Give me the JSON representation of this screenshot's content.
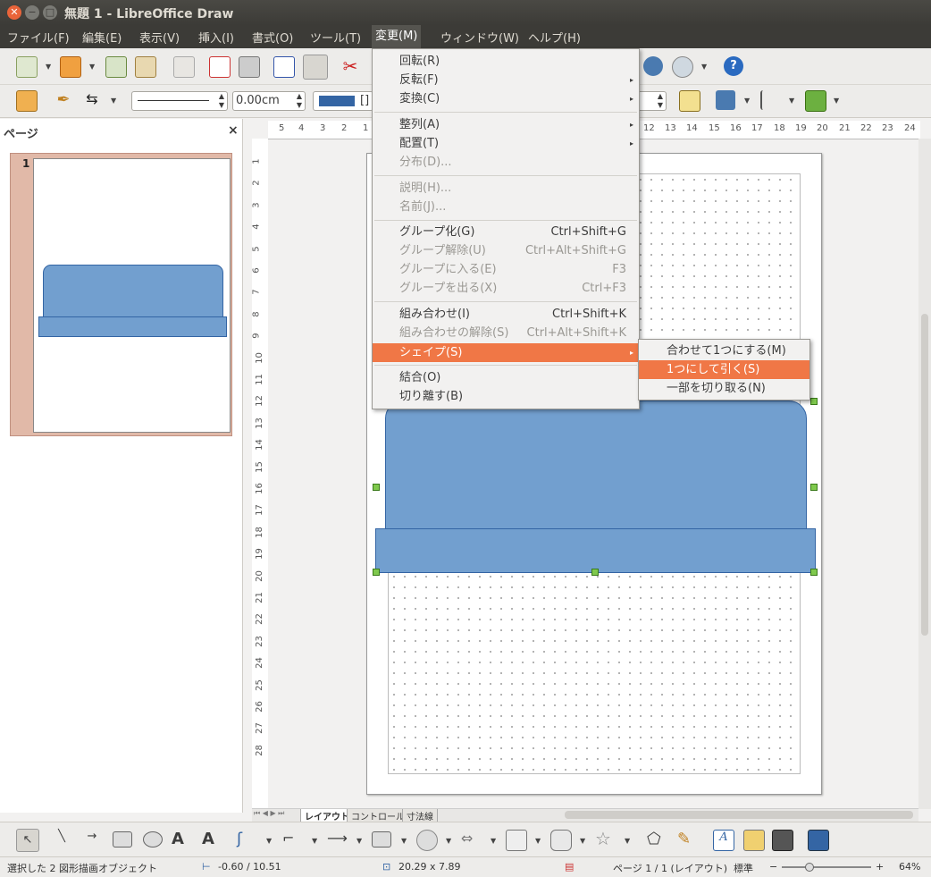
{
  "window": {
    "title": "無題 1 - LibreOffice Draw"
  },
  "menubar": [
    {
      "label": "ファイル(F)"
    },
    {
      "label": "編集(E)"
    },
    {
      "label": "表示(V)"
    },
    {
      "label": "挿入(I)"
    },
    {
      "label": "書式(O)"
    },
    {
      "label": "ツール(T)"
    },
    {
      "label": "変更(M)"
    },
    {
      "label": "ウィンドウ(W)"
    },
    {
      "label": "ヘルプ(H)"
    }
  ],
  "toolbar2": {
    "line_width": "0.00cm",
    "area_value": "[]"
  },
  "pages_pane": {
    "title": "ページ",
    "close": "×",
    "page_number": "1"
  },
  "ruler_h": [
    "5",
    "4",
    "3",
    "2",
    "1",
    "12",
    "13",
    "14",
    "15",
    "16",
    "17",
    "18",
    "19",
    "20",
    "21",
    "22",
    "23",
    "24"
  ],
  "ruler_v": [
    "1",
    "2",
    "3",
    "4",
    "5",
    "6",
    "7",
    "8",
    "9",
    "10",
    "11",
    "12",
    "13",
    "14",
    "15",
    "16",
    "17",
    "18",
    "19",
    "20",
    "21",
    "22",
    "23",
    "24",
    "25",
    "26",
    "27",
    "28"
  ],
  "modify_menu": {
    "items": [
      {
        "label": "回転(R)"
      },
      {
        "label": "反転(F)"
      },
      {
        "label": "変換(C)"
      },
      {
        "label": "整列(A)"
      },
      {
        "label": "配置(T)"
      },
      {
        "label": "分布(D)..."
      },
      {
        "label": "説明(H)..."
      },
      {
        "label": "名前(J)..."
      },
      {
        "label": "グループ化(G)",
        "shortcut": "Ctrl+Shift+G"
      },
      {
        "label": "グループ解除(U)",
        "shortcut": "Ctrl+Alt+Shift+G"
      },
      {
        "label": "グループに入る(E)",
        "shortcut": "F3"
      },
      {
        "label": "グループを出る(X)",
        "shortcut": "Ctrl+F3"
      },
      {
        "label": "組み合わせ(I)",
        "shortcut": "Ctrl+Shift+K"
      },
      {
        "label": "組み合わせの解除(S)",
        "shortcut": "Ctrl+Alt+Shift+K"
      },
      {
        "label": "シェイプ(S)"
      },
      {
        "label": "結合(O)"
      },
      {
        "label": "切り離す(B)"
      }
    ]
  },
  "shape_submenu": {
    "items": [
      {
        "label": "合わせて1つにする(M)"
      },
      {
        "label": "1つにして引く(S)"
      },
      {
        "label": "一部を切り取る(N)"
      }
    ]
  },
  "sheet_tabs": [
    "レイアウト",
    "コントロール",
    "寸法線"
  ],
  "status": {
    "selection": "選択した 2 図形描画オブジェクト",
    "position": "-0.60 / 10.51",
    "size": "20.29 x 7.89",
    "page": "ページ 1 / 1 (レイアウト)",
    "style": "標準",
    "zoom": "64%",
    "zoom_minus": "−",
    "zoom_plus": "+"
  },
  "colors": {
    "shape_fill": "#729fcf",
    "shape_border": "#3465a4",
    "menu_highlight": "#f07746"
  }
}
